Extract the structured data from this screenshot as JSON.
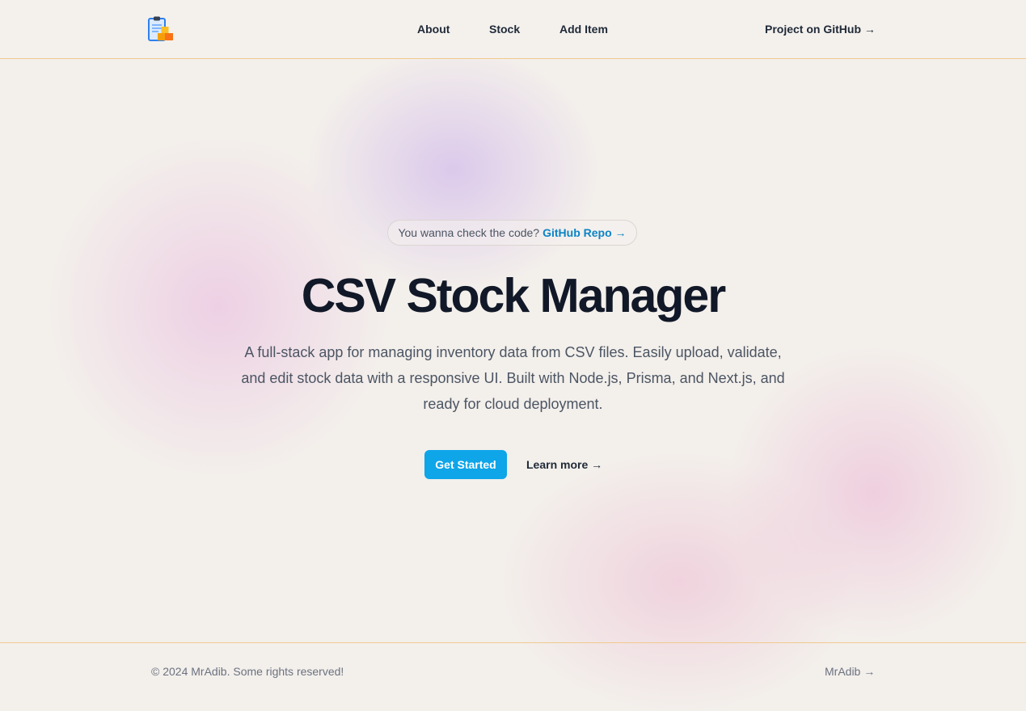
{
  "header": {
    "logo_icon": "clipboard-boxes-icon",
    "nav": {
      "about": "About",
      "stock": "Stock",
      "add_item": "Add Item"
    },
    "github_link": "Project on GitHub →"
  },
  "hero": {
    "announcement": {
      "text": "You wanna check the code?",
      "link": "GitHub Repo →"
    },
    "title": "CSV Stock Manager",
    "description": "A full-stack app for managing inventory data from CSV files. Easily upload, validate, and edit stock data with a responsive UI. Built with Node.js, Prisma, and Next.js, and ready for cloud deployment.",
    "primary_button": "Get Started",
    "secondary_link": "Learn more →"
  },
  "footer": {
    "copyright": "© 2024 MrAdib. Some rights reserved!",
    "author_link": "MrAdib →"
  },
  "colors": {
    "accent": "#0ea5e9",
    "link": "#0b84c6",
    "border": "#f0c98c",
    "background": "#f3efeb",
    "heading": "#111827"
  }
}
